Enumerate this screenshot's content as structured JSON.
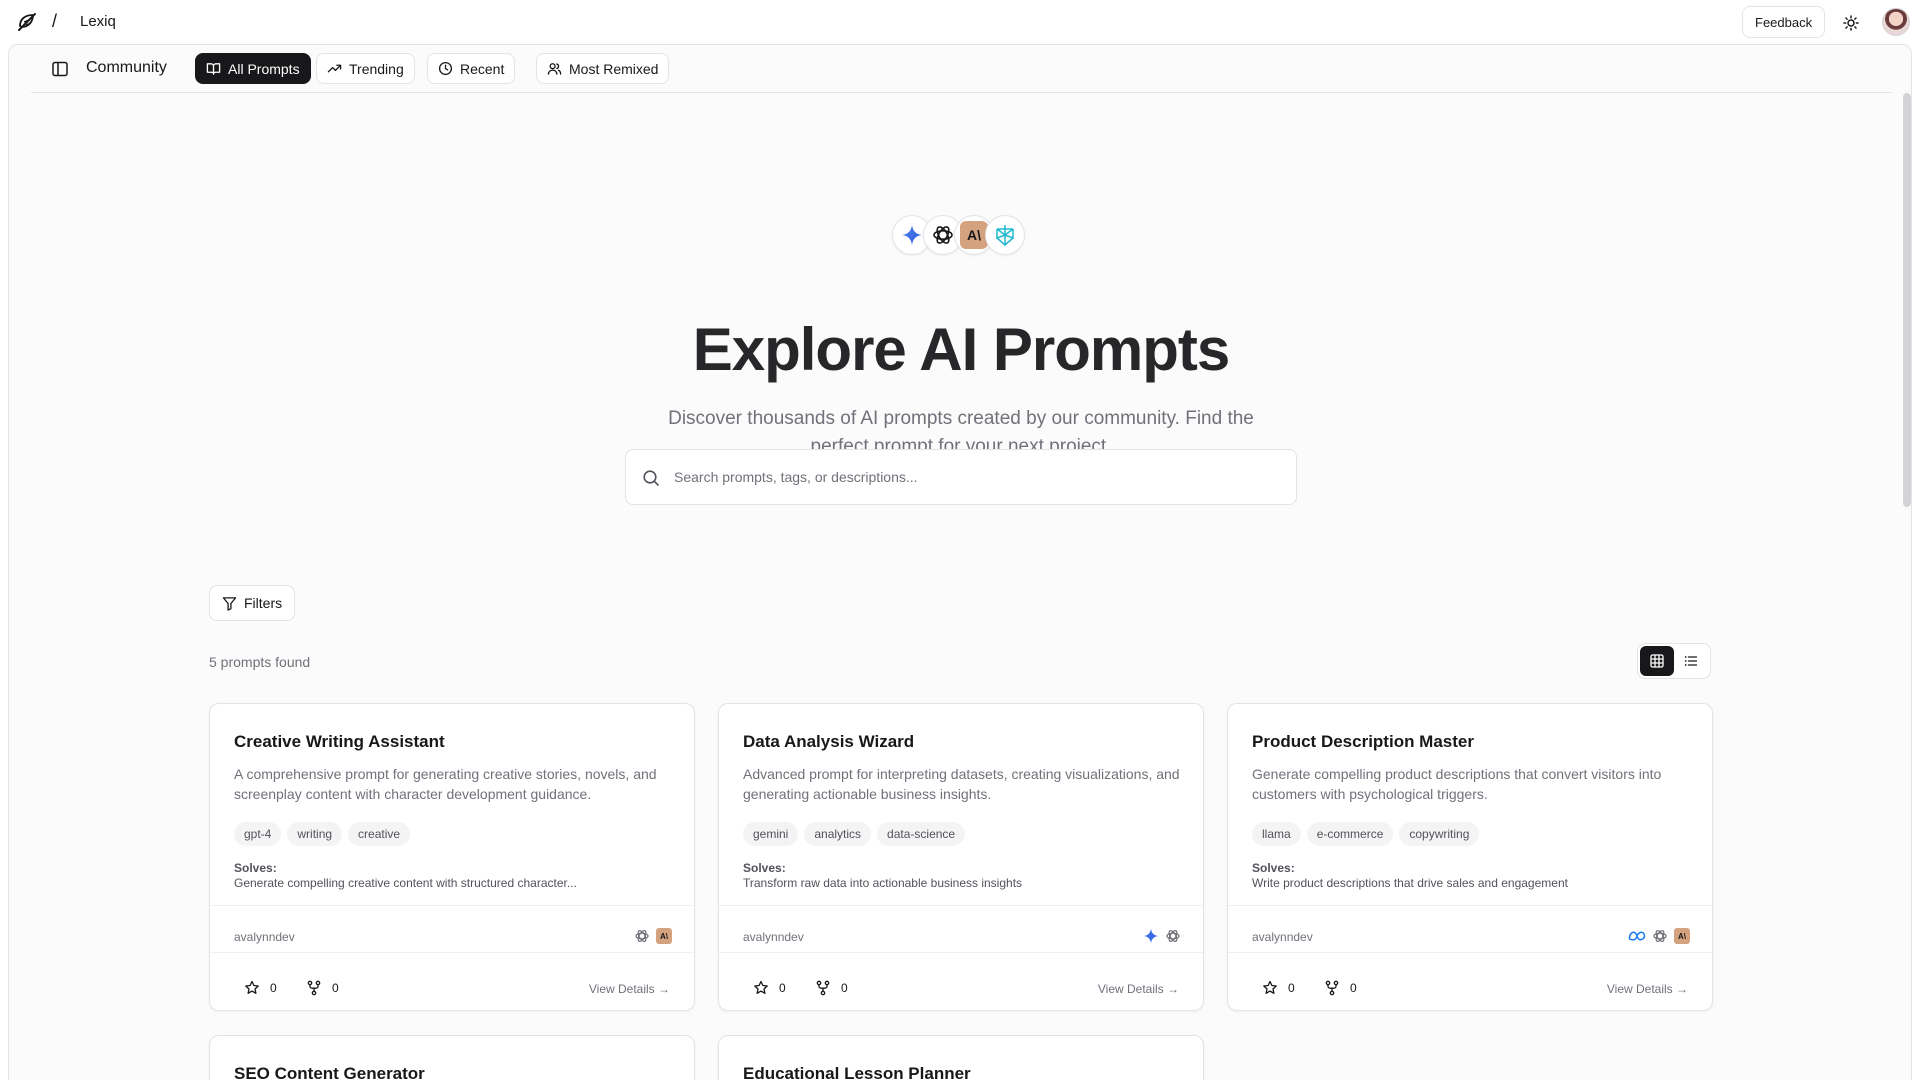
{
  "app": {
    "name": "Lexiq",
    "breadcrumb_separator": "/"
  },
  "topbar": {
    "feedback_label": "Feedback"
  },
  "subnav": {
    "section_title": "Community",
    "tabs": [
      {
        "label": "All Prompts",
        "icon": "book-open-icon",
        "active": true
      },
      {
        "label": "Trending",
        "icon": "trending-up-icon",
        "active": false
      },
      {
        "label": "Recent",
        "icon": "clock-icon",
        "active": false
      },
      {
        "label": "Most Remixed",
        "icon": "users-icon",
        "active": false
      }
    ]
  },
  "hero": {
    "model_icons": [
      "gemini-icon",
      "openai-icon",
      "anthropic-icon",
      "perplexity-icon"
    ],
    "title": "Explore AI Prompts",
    "subtitle": "Discover thousands of AI prompts created by our community. Find the perfect prompt for your next project.",
    "search_placeholder": "Search prompts, tags, or descriptions..."
  },
  "toolbar": {
    "filters_label": "Filters",
    "result_count": "5 prompts found",
    "view_mode": "grid"
  },
  "cards": [
    {
      "title": "Creative Writing Assistant",
      "description": "A comprehensive prompt for generating creative stories, novels, and screenplay content with character development guidance.",
      "tags": [
        "gpt-4",
        "writing",
        "creative"
      ],
      "solves_label": "Solves:",
      "solves": "Generate compelling creative content with structured character...",
      "author": "avalynndev",
      "models": [
        "openai-icon",
        "anthropic-icon"
      ],
      "stars": "0",
      "forks": "0",
      "view_label": "View Details →"
    },
    {
      "title": "Data Analysis Wizard",
      "description": "Advanced prompt for interpreting datasets, creating visualizations, and generating actionable business insights.",
      "tags": [
        "gemini",
        "analytics",
        "data-science"
      ],
      "solves_label": "Solves:",
      "solves": "Transform raw data into actionable business insights",
      "author": "avalynndev",
      "models": [
        "gemini-icon",
        "openai-icon"
      ],
      "stars": "0",
      "forks": "0",
      "view_label": "View Details →"
    },
    {
      "title": "Product Description Master",
      "description": "Generate compelling product descriptions that convert visitors into customers with psychological triggers.",
      "tags": [
        "llama",
        "e-commerce",
        "copywriting"
      ],
      "solves_label": "Solves:",
      "solves": "Write product descriptions that drive sales and engagement",
      "author": "avalynndev",
      "models": [
        "meta-icon",
        "openai-icon",
        "anthropic-icon"
      ],
      "stars": "0",
      "forks": "0",
      "view_label": "View Details →"
    },
    {
      "title": "SEO Content Generator"
    },
    {
      "title": "Educational Lesson Planner"
    }
  ]
}
